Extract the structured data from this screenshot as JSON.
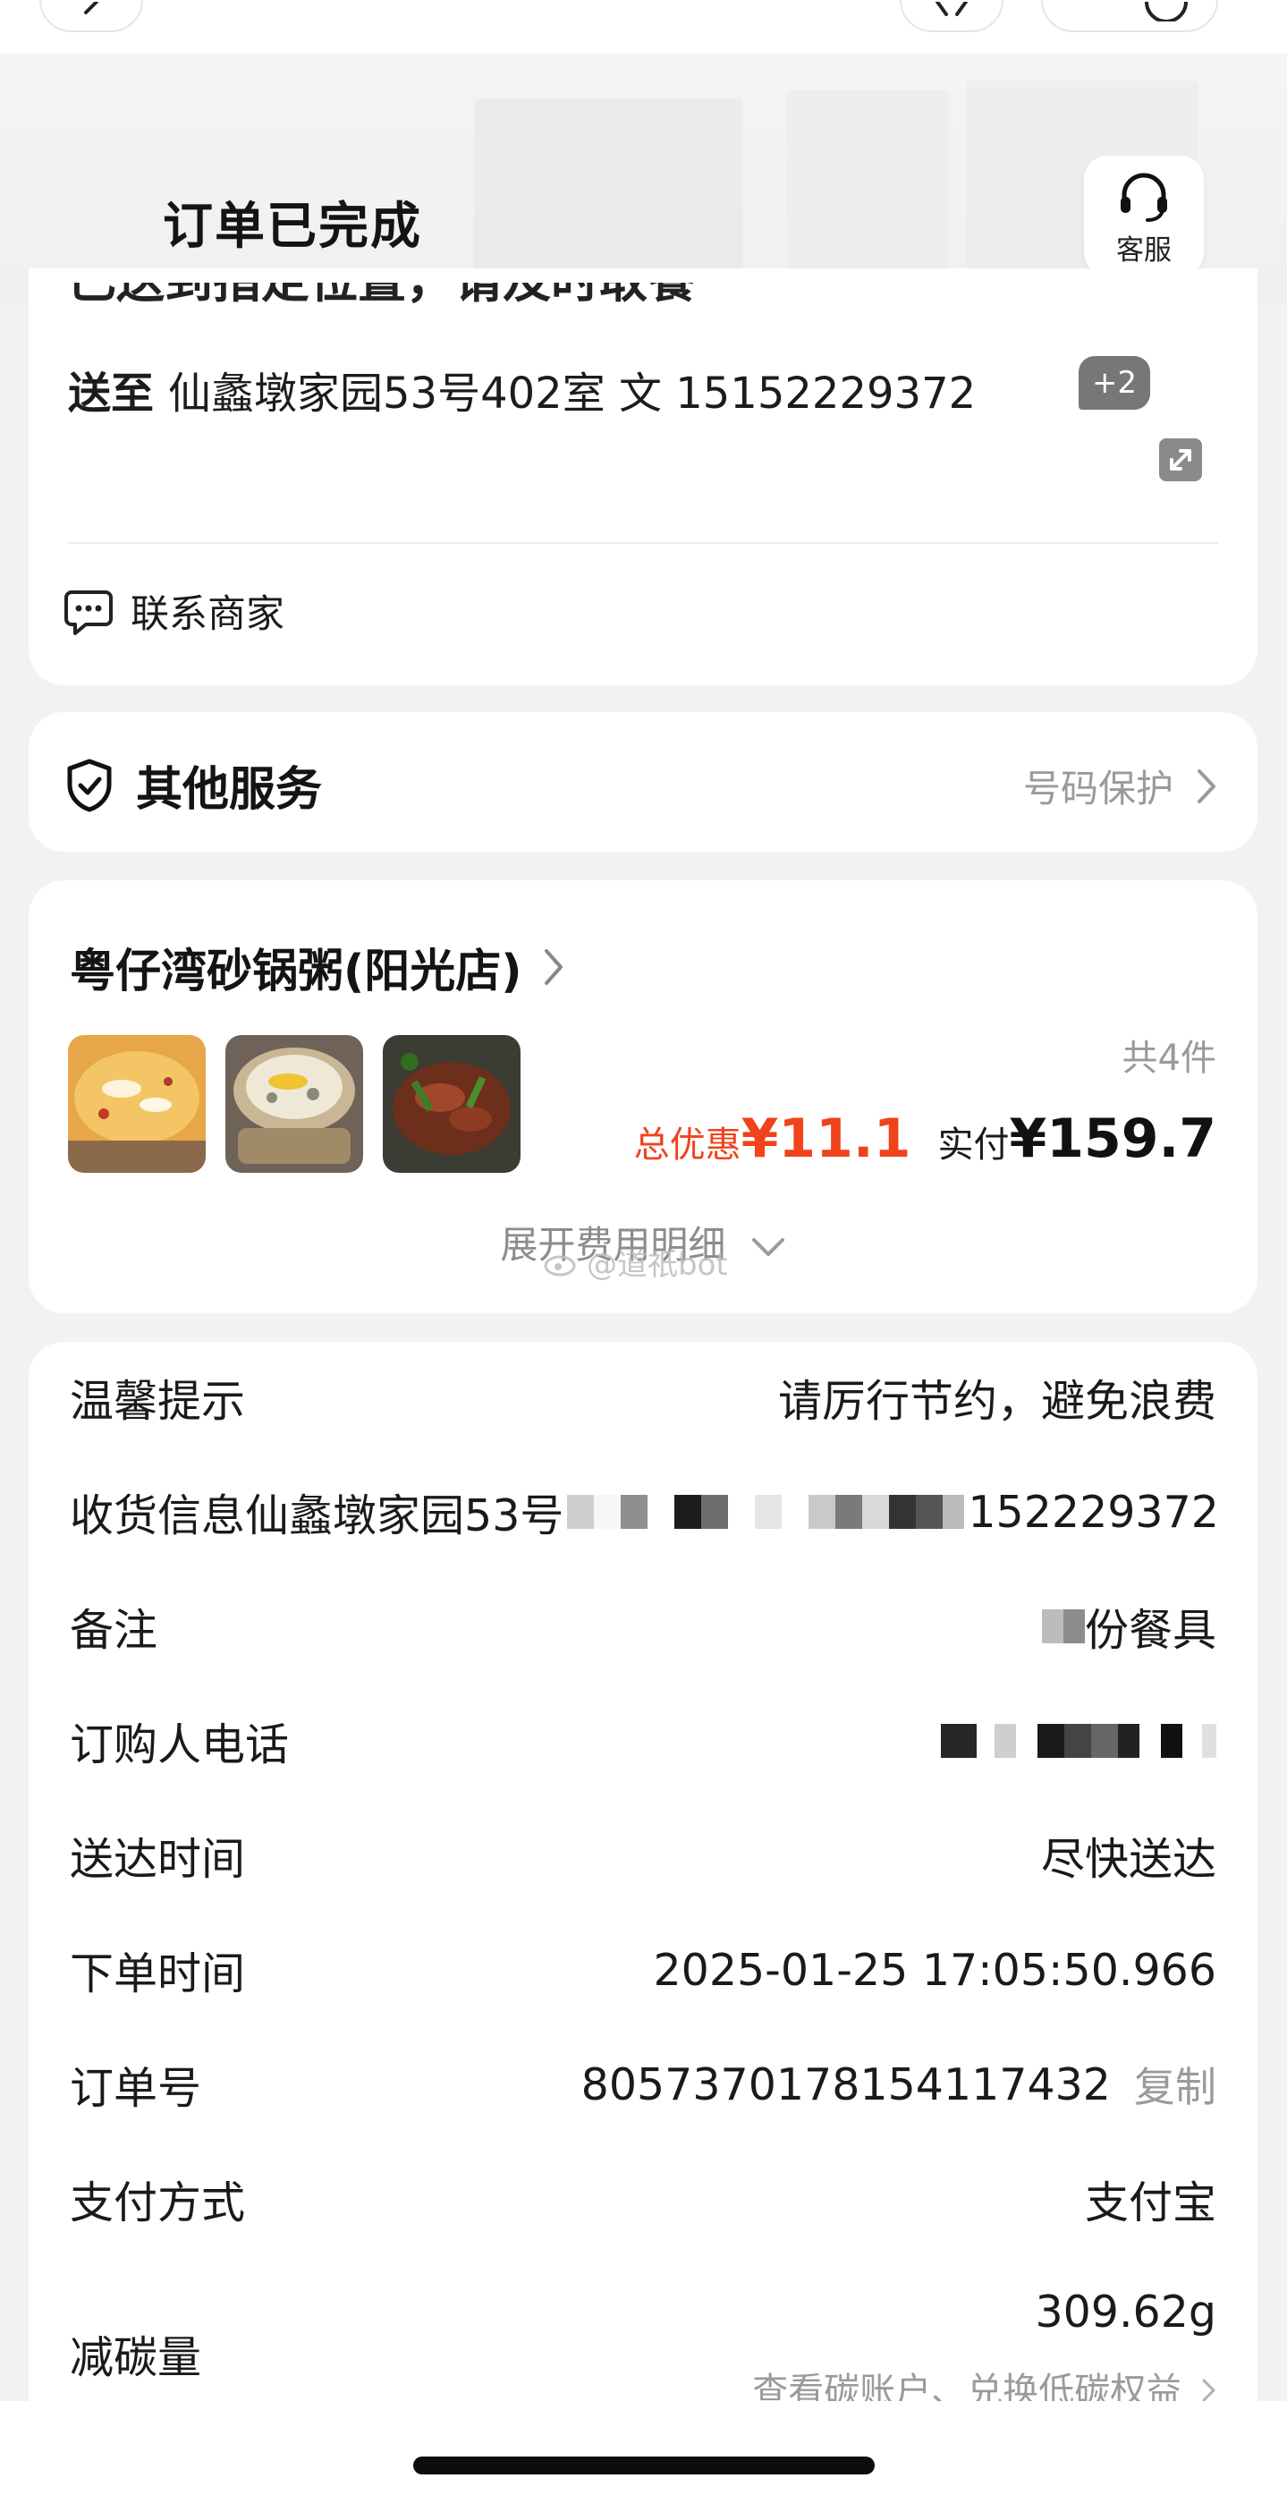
{
  "header": {
    "title": "订单已完成",
    "service_label": "客服"
  },
  "address_card": {
    "cut_off_status": "已送到指定位置，请及时取餐",
    "deliver_prefix": "送至",
    "address": "仙蠡墩家园53号402室 文 15152229372",
    "extra_badge": "+2",
    "contact_merchant": "联系商家"
  },
  "other_services": {
    "title": "其他服务",
    "right_label": "号码保护"
  },
  "store": {
    "name": "粤仔湾砂锅粥(阳光店)",
    "item_count": "共4件",
    "discount_label": "总优惠",
    "discount_value": "¥11.1",
    "paid_label": "实付",
    "paid_value": "¥159.7",
    "expand_fees": "展开费用明细"
  },
  "watermark": "@道祇bot",
  "details": {
    "rows": [
      {
        "key": "温馨提示",
        "value": "请厉行节约，避免浪费"
      },
      {
        "key": "收货信息",
        "value_prefix": "仙蠡墩家园53号",
        "value_suffix": "152229372"
      },
      {
        "key": "备注",
        "value_suffix": "份餐具"
      },
      {
        "key": "订购人电话",
        "value": ""
      },
      {
        "key": "送达时间",
        "value": "尽快送达"
      },
      {
        "key": "下单时间",
        "value": "2025-01-25 17:05:50.966"
      },
      {
        "key": "订单号",
        "value": "8057370178154117432",
        "action": "复制"
      },
      {
        "key": "支付方式",
        "value": "支付宝"
      }
    ],
    "carbon": {
      "key": "减碳量",
      "value": "309.62g",
      "sub": "查看碳账户、兑换低碳权益"
    }
  },
  "colors": {
    "accent_red": "#f0431b",
    "muted_gray": "#9a9a9a"
  }
}
